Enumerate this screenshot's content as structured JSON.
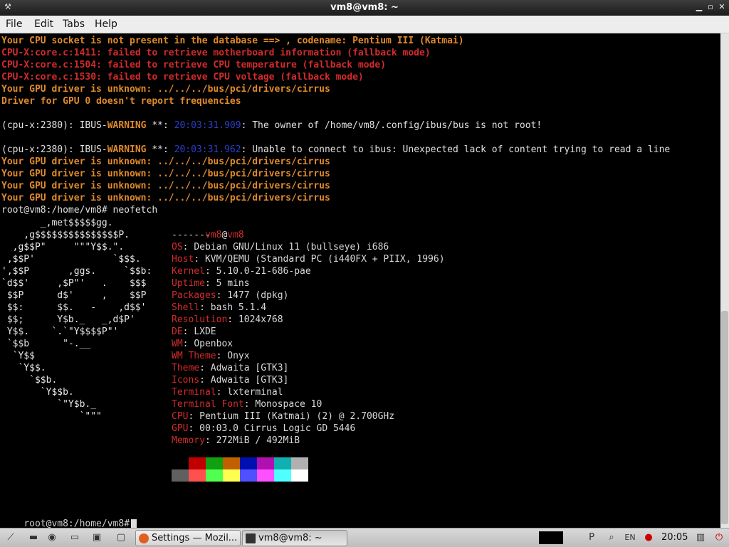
{
  "window": {
    "title": "vm8@vm8: ~"
  },
  "menu": [
    "File",
    "Edit",
    "Tabs",
    "Help"
  ],
  "terminal": {
    "lines": [
      {
        "segments": [
          {
            "t": "Your CPU socket is not present in the database ==> , codename: Pentium III (Katmai)",
            "c": "orange"
          }
        ]
      },
      {
        "segments": [
          {
            "t": "CPU-X:core.c:1411: failed to retrieve motherboard information (fallback mode)",
            "c": "red"
          }
        ]
      },
      {
        "segments": [
          {
            "t": "CPU-X:core.c:1504: failed to retrieve CPU temperature (fallback mode)",
            "c": "red"
          }
        ]
      },
      {
        "segments": [
          {
            "t": "CPU-X:core.c:1530: failed to retrieve CPU voltage (fallback mode)",
            "c": "red"
          }
        ]
      },
      {
        "segments": [
          {
            "t": "Your GPU driver is unknown: ../../../bus/pci/drivers/cirrus",
            "c": "orange"
          }
        ]
      },
      {
        "segments": [
          {
            "t": "Driver for GPU 0 doesn't report frequencies",
            "c": "orange"
          }
        ]
      },
      {
        "segments": [
          {
            "t": "",
            "c": "white"
          }
        ]
      },
      {
        "segments": [
          {
            "t": "(cpu-x:2380): IBUS-",
            "c": "white"
          },
          {
            "t": "WARNING",
            "c": "warn"
          },
          {
            "t": " **: ",
            "c": "white"
          },
          {
            "t": "20:03:31.909",
            "c": "blue"
          },
          {
            "t": ": The owner of /home/vm8/.config/ibus/bus is not root!",
            "c": "white"
          }
        ]
      },
      {
        "segments": [
          {
            "t": "",
            "c": "white"
          }
        ]
      },
      {
        "segments": [
          {
            "t": "(cpu-x:2380): IBUS-",
            "c": "white"
          },
          {
            "t": "WARNING",
            "c": "warn"
          },
          {
            "t": " **: ",
            "c": "white"
          },
          {
            "t": "20:03:31.962",
            "c": "blue"
          },
          {
            "t": ": Unable to connect to ibus: Unexpected lack of content trying to read a line",
            "c": "white"
          }
        ]
      },
      {
        "segments": [
          {
            "t": "Your GPU driver is unknown: ../../../bus/pci/drivers/cirrus",
            "c": "orange"
          }
        ]
      },
      {
        "segments": [
          {
            "t": "Your GPU driver is unknown: ../../../bus/pci/drivers/cirrus",
            "c": "orange"
          }
        ]
      },
      {
        "segments": [
          {
            "t": "Your GPU driver is unknown: ../../../bus/pci/drivers/cirrus",
            "c": "orange"
          }
        ]
      },
      {
        "segments": [
          {
            "t": "Your GPU driver is unknown: ../../../bus/pci/drivers/cirrus",
            "c": "orange"
          }
        ]
      },
      {
        "segments": [
          {
            "t": "root@vm8:/home/vm8# neofetch",
            "c": "white"
          }
        ]
      }
    ],
    "prompt": "root@vm8:/home/vm8#"
  },
  "neofetch": {
    "art": [
      "       _,met$$$$$gg.",
      "    ,g$$$$$$$$$$$$$$$P.",
      "  ,g$$P\"     \"\"\"Y$$.\".",
      " ,$$P'              `$$$.",
      "',$$P       ,ggs.     `$$b:",
      "`d$$'     ,$P\"'   .    $$$",
      " $$P      d$'     ,    $$P",
      " $$:      $$.   -    ,d$$'",
      " $$;      Y$b._   _,d$P'",
      " Y$$.    `.`\"Y$$$$P\"'",
      " `$$b      \"-.__",
      "  `Y$$",
      "   `Y$$.",
      "     `$$b.",
      "       `Y$$b.",
      "          `\"Y$b._",
      "              `\"\"\""
    ],
    "header_user": "vm8",
    "header_at": "@",
    "header_host": "vm8",
    "separator": "-------",
    "info": [
      {
        "key": "OS",
        "value": "Debian GNU/Linux 11 (bullseye) i686"
      },
      {
        "key": "Host",
        "value": "KVM/QEMU (Standard PC (i440FX + PIIX, 1996)"
      },
      {
        "key": "Kernel",
        "value": "5.10.0-21-686-pae"
      },
      {
        "key": "Uptime",
        "value": "5 mins"
      },
      {
        "key": "Packages",
        "value": "1477 (dpkg)"
      },
      {
        "key": "Shell",
        "value": "bash 5.1.4"
      },
      {
        "key": "Resolution",
        "value": "1024x768"
      },
      {
        "key": "DE",
        "value": "LXDE"
      },
      {
        "key": "WM",
        "value": "Openbox"
      },
      {
        "key": "WM Theme",
        "value": "Onyx"
      },
      {
        "key": "Theme",
        "value": "Adwaita [GTK3]"
      },
      {
        "key": "Icons",
        "value": "Adwaita [GTK3]"
      },
      {
        "key": "Terminal",
        "value": "lxterminal"
      },
      {
        "key": "Terminal Font",
        "value": "Monospace 10"
      },
      {
        "key": "CPU",
        "value": "Pentium III (Katmai) (2) @ 2.700GHz"
      },
      {
        "key": "GPU",
        "value": "00:03.0 Cirrus Logic GD 5446"
      },
      {
        "key": "Memory",
        "value": "272MiB / 492MiB"
      }
    ],
    "palette_row1": [
      "#000000",
      "#c00000",
      "#10a010",
      "#c06000",
      "#0010b0",
      "#b010b0",
      "#10b0b0",
      "#b0b0b0"
    ],
    "palette_row2": [
      "#606060",
      "#ff5050",
      "#50ff50",
      "#ffff50",
      "#5050ff",
      "#ff50ff",
      "#50ffff",
      "#ffffff"
    ]
  },
  "taskbar": {
    "tasks": [
      {
        "label": "Settings — Mozil...",
        "icon": "firefox-icon"
      },
      {
        "label": "vm8@vm8: ~",
        "icon": "terminal-icon"
      }
    ],
    "lang": "EN",
    "clock": "20:05"
  }
}
